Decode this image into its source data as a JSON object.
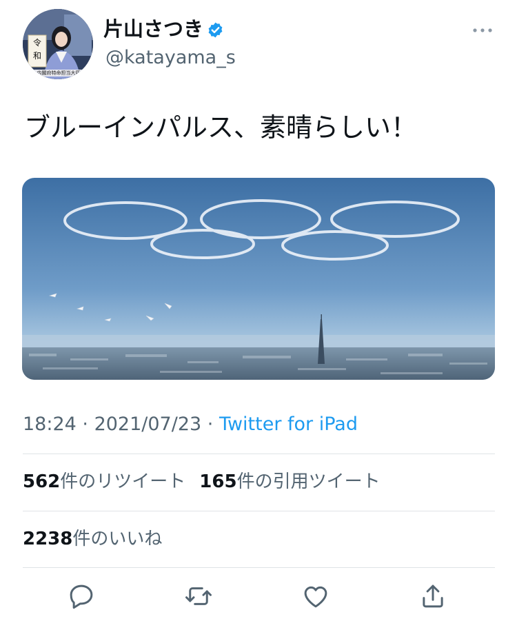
{
  "author": {
    "display_name": "片山さつき",
    "handle": "@katayama_s",
    "avatar_sign": "令\n和",
    "avatar_nameplate": "内閣府特命担当大臣"
  },
  "tweet": {
    "text": "ブルーインパルス、素晴らしい！"
  },
  "meta": {
    "time": "18:24",
    "separator1": " · ",
    "date": "2021/07/23",
    "separator2": " · ",
    "source": "Twitter for iPad"
  },
  "stats": {
    "retweets_count": "562",
    "retweets_label": "件のリツイート",
    "quotes_count": "165",
    "quotes_label": "件の引用ツイート",
    "likes_count": "2238",
    "likes_label": "件のいいね"
  },
  "icons": {
    "verified": "verified-badge-icon",
    "more": "more-horizontal-icon",
    "reply": "reply-icon",
    "retweet": "retweet-icon",
    "like": "heart-icon",
    "share": "share-icon"
  },
  "colors": {
    "accent": "#1d9bf0",
    "secondary_text": "#536471",
    "divider": "#dfe3e6"
  }
}
